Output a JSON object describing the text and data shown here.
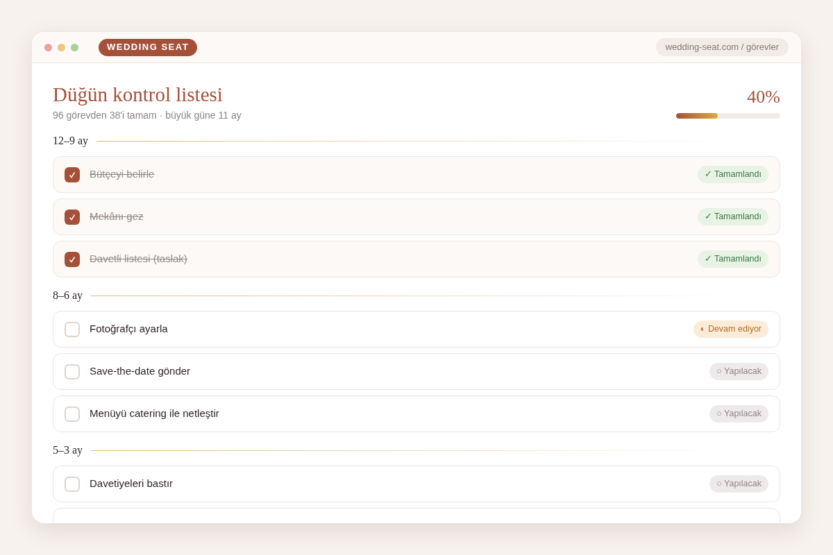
{
  "window": {
    "brand": "WEDDING SEAT",
    "url": "wedding-seat.com / görevler"
  },
  "header": {
    "title": "Düğün kontrol listesi",
    "subtitle": "96 görevden 38'i tamam · büyük güne 11 ay",
    "percent": "40%",
    "level": 0.4
  },
  "sections": [
    {
      "label": "12–9 ay",
      "tasks": [
        {
          "name": "Bütçeyi belirle",
          "checked": true,
          "status": {
            "kind": "done",
            "text": "✓ Tamamlandı"
          }
        },
        {
          "name": "Mekânı gez",
          "checked": true,
          "status": {
            "kind": "done",
            "text": "✓ Tamamlandı"
          }
        },
        {
          "name": "Davetli listesi (taslak)",
          "checked": true,
          "status": {
            "kind": "done",
            "text": "✓ Tamamlandı"
          }
        }
      ]
    },
    {
      "label": "8–6 ay",
      "tasks": [
        {
          "name": "Fotoğrafçı ayarla",
          "checked": false,
          "status": {
            "kind": "progress",
            "text": "◐ Devam ediyor"
          }
        },
        {
          "name": "Save-the-date gönder",
          "checked": false,
          "status": {
            "kind": "todo",
            "text": "○ Yapılacak"
          }
        },
        {
          "name": "Menüyü catering ile netleştir",
          "checked": false,
          "status": {
            "kind": "todo",
            "text": "○ Yapılacak"
          }
        }
      ]
    },
    {
      "label": "5–3 ay",
      "tasks": [
        {
          "name": "Davetiyeleri bastır",
          "checked": false,
          "status": {
            "kind": "todo",
            "text": "○ Yapılacak"
          }
        }
      ]
    }
  ]
}
